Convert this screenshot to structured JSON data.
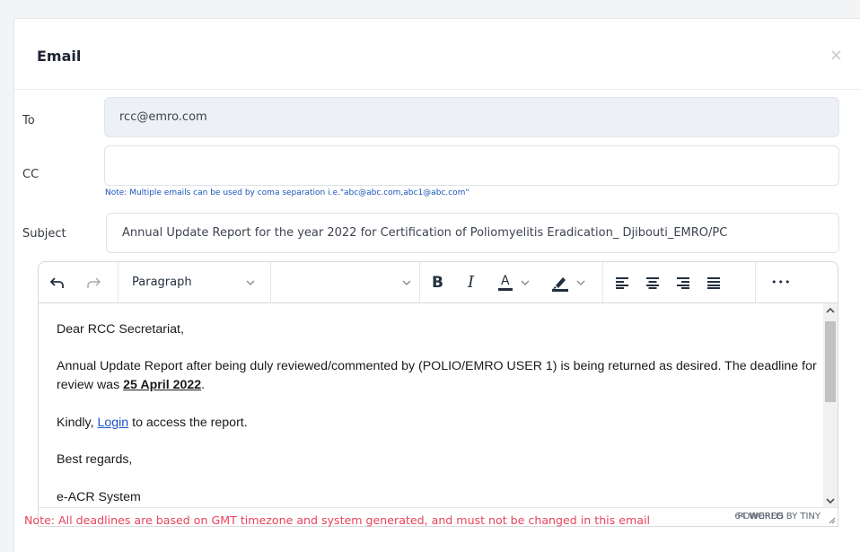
{
  "modal": {
    "title": "Email",
    "close_glyph": "×"
  },
  "fields": {
    "to": {
      "label": "To",
      "value": "rcc@emro.com"
    },
    "cc": {
      "label": "CC",
      "value": ""
    },
    "cc_note": "Note: Multiple emails can be used by coma separation i.e.\"abc@abc.com,abc1@abc.com\"",
    "subject": {
      "label": "Subject",
      "value": "Annual Update Report for the year 2022 for Certification of Poliomyelitis Eradication_ Djibouti_EMRO/PC"
    }
  },
  "toolbar": {
    "block_format": "Paragraph",
    "font_select": "",
    "bold": "B",
    "italic": "I",
    "text_color": "A",
    "more": "•••",
    "icons": [
      "undo-icon",
      "redo-icon",
      "chevron-down-icon",
      "bold-icon",
      "italic-icon",
      "text-color-icon",
      "highlight-icon",
      "align-left-icon",
      "align-center-icon",
      "align-right-icon",
      "justify-icon",
      "more-icon"
    ]
  },
  "body": {
    "greeting": "Dear RCC Secretariat,",
    "paragraph1_part1": "Annual Update Report after being duly reviewed/commented by (POLIO/EMRO USER 1) is being returned as desired. The deadline for review was ",
    "deadline": "25 April 2022",
    "paragraph1_end": ".",
    "paragraph2_prefix": "Kindly, ",
    "login_link": "Login",
    "paragraph2_suffix": " to access the report.",
    "closing": "Best regards,",
    "signature": "e-ACR System"
  },
  "status": {
    "word_count": "64 WORDS",
    "powered_by": "POWERED BY TINY"
  },
  "warning": "Note: All deadlines are based on GMT timezone and system generated, and must not be changed in this email",
  "colors": {
    "warning": "#e8445a",
    "link": "#1a56c8",
    "note": "#1a56b8",
    "readonly_bg": "#edf1f5"
  }
}
